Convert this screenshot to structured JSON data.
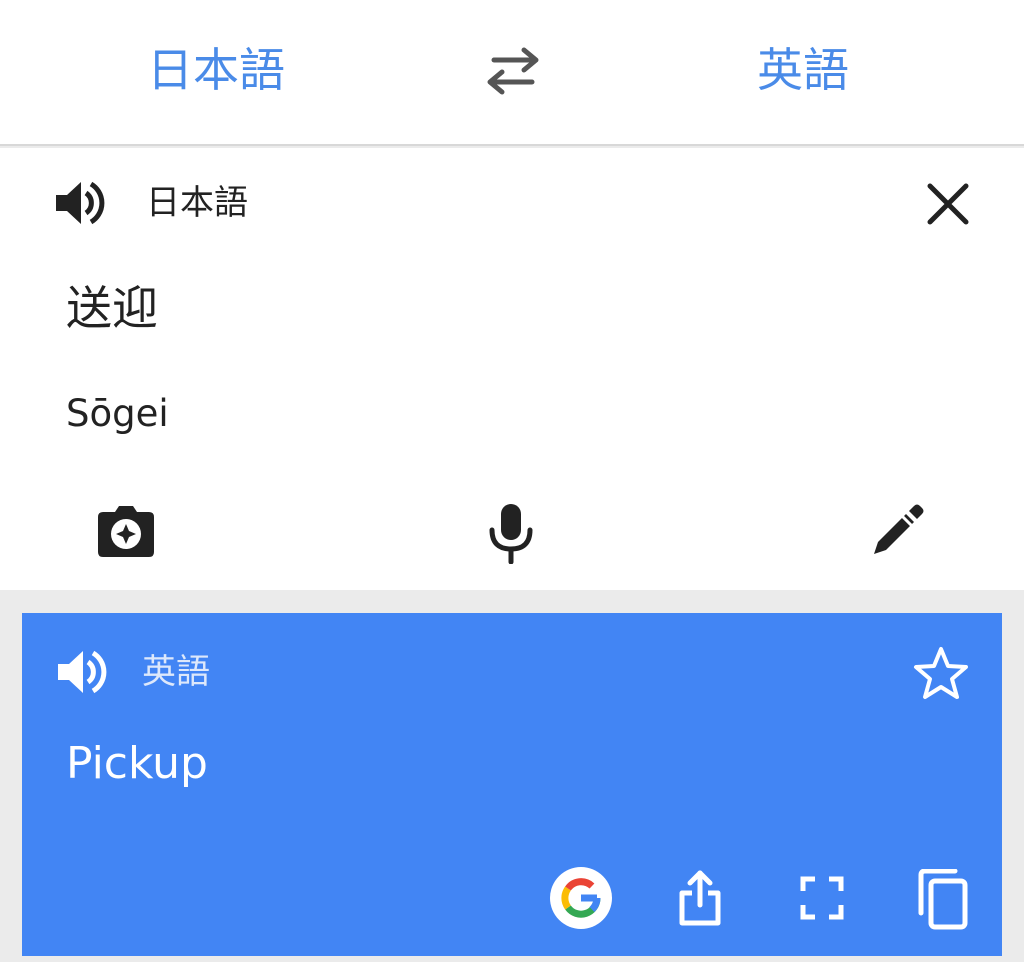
{
  "language_bar": {
    "source_language": "日本語",
    "target_language": "英語"
  },
  "input_card": {
    "language_label": "日本語",
    "source_text": "送迎",
    "romanization": "Sōgei"
  },
  "result_card": {
    "language_label": "英語",
    "translation": "Pickup"
  },
  "icons": {
    "swap": "swap-languages-icon",
    "speaker": "speaker-icon",
    "close": "close-icon",
    "camera": "camera-icon",
    "microphone": "microphone-icon",
    "handwriting": "pen-icon",
    "star": "star-outline-icon",
    "google": "google-logo-icon",
    "share": "share-icon",
    "fullscreen": "fullscreen-icon",
    "copy": "copy-icon"
  },
  "colors": {
    "accent_blue": "#4285f4",
    "language_link": "#4a8be8",
    "text_dark": "#222222",
    "background_gray": "#ebebeb"
  }
}
